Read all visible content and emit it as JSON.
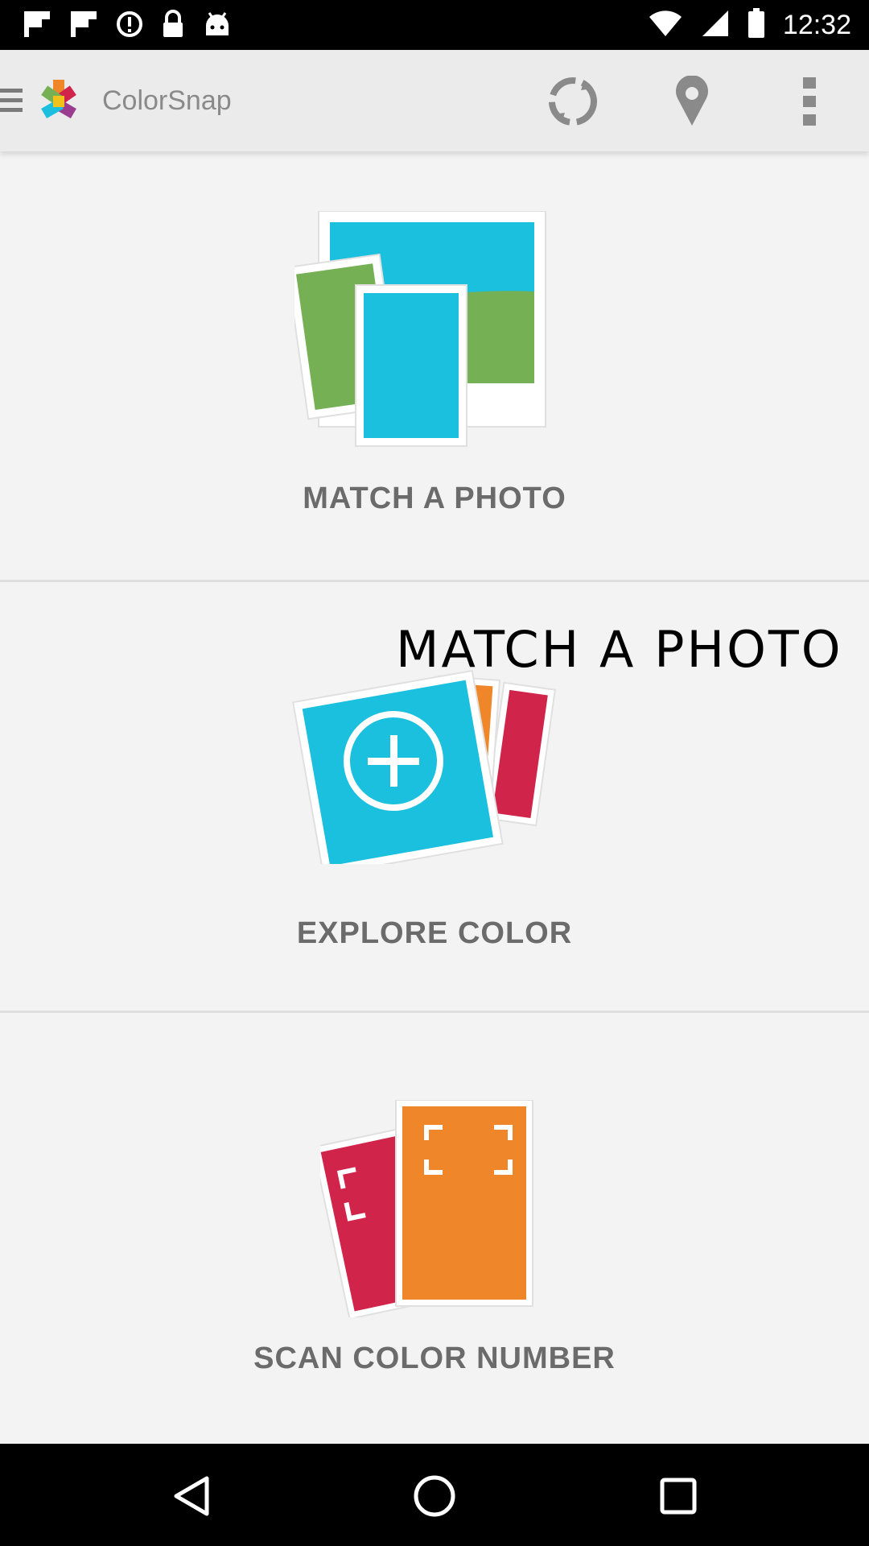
{
  "status_bar": {
    "time": "12:32",
    "icons": [
      "flipboard-icon",
      "flipboard-icon",
      "alert-icon",
      "lock-icon",
      "android-icon",
      "wifi-icon",
      "signal-icon",
      "battery-icon"
    ]
  },
  "action_bar": {
    "title": "ColorSnap",
    "actions": [
      "sync-icon",
      "location-pin-icon",
      "overflow-menu-icon"
    ]
  },
  "sections": [
    {
      "label": "MATCH A PHOTO",
      "icon": "photos-icon"
    },
    {
      "label": "EXPLORE COLOR",
      "icon": "color-cards-plus-icon"
    },
    {
      "label": "SCAN COLOR NUMBER",
      "icon": "scan-cards-icon"
    }
  ],
  "overlay": {
    "text": "MATCH A PHOTO"
  },
  "colors": {
    "blue": "#1bc0df",
    "green": "#76b055",
    "orange": "#f0862a",
    "red": "#d1244b",
    "label": "#6b6b6b"
  },
  "nav_bar": [
    "back-icon",
    "home-icon",
    "recents-icon"
  ]
}
